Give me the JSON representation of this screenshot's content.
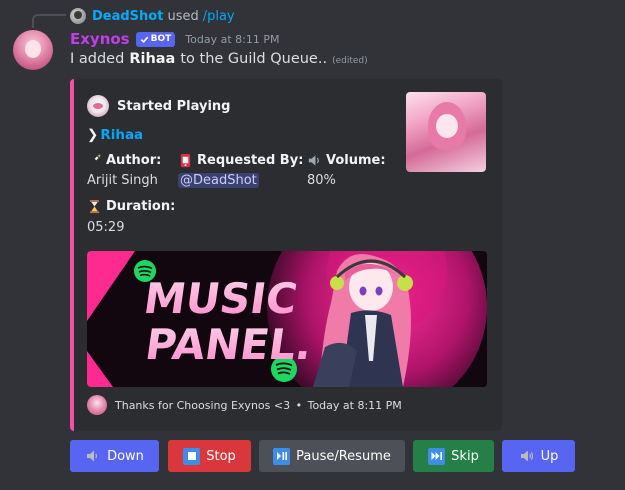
{
  "reply": {
    "username": "DeadShot",
    "used_text": "used",
    "command": "/play"
  },
  "message": {
    "username": "Exynos",
    "bot_tag": "BOT",
    "timestamp": "Today at 8:11 PM",
    "text_before": "I added",
    "song_bold": "Rihaa",
    "text_after": "to the Guild Queue..",
    "edited_label": "(edited)"
  },
  "embed": {
    "accent_color": "#f450a5",
    "author_name": "Started Playing",
    "title": "Rihaa",
    "title_prefix": "❯",
    "fields": {
      "author_label": "Author:",
      "author_value": "Arijit Singh",
      "requested_label": "Requested By:",
      "requested_value": "@DeadShot",
      "volume_label": "Volume:",
      "volume_value": "80%",
      "duration_label": "Duration:",
      "duration_value": "05:29"
    },
    "banner": {
      "line1": "MUSIC",
      "line2": "PANEL."
    },
    "footer_text": "Thanks for Choosing Exynos <3",
    "footer_timestamp": "Today at 8:11 PM",
    "footer_sep": "•"
  },
  "buttons": {
    "down": "Down",
    "stop": "Stop",
    "pause_resume": "Pause/Resume",
    "skip": "Skip",
    "up": "Up"
  },
  "icons": {
    "author_field": "magic-wand-icon",
    "requested_field": "paper-note-icon",
    "volume_field": "speaker-icon",
    "duration_field": "hourglass-icon",
    "down_button": "speaker-low-icon",
    "stop_button": "stop-icon",
    "pause_button": "play-pause-icon",
    "skip_button": "fast-forward-icon",
    "up_button": "speaker-high-icon"
  }
}
